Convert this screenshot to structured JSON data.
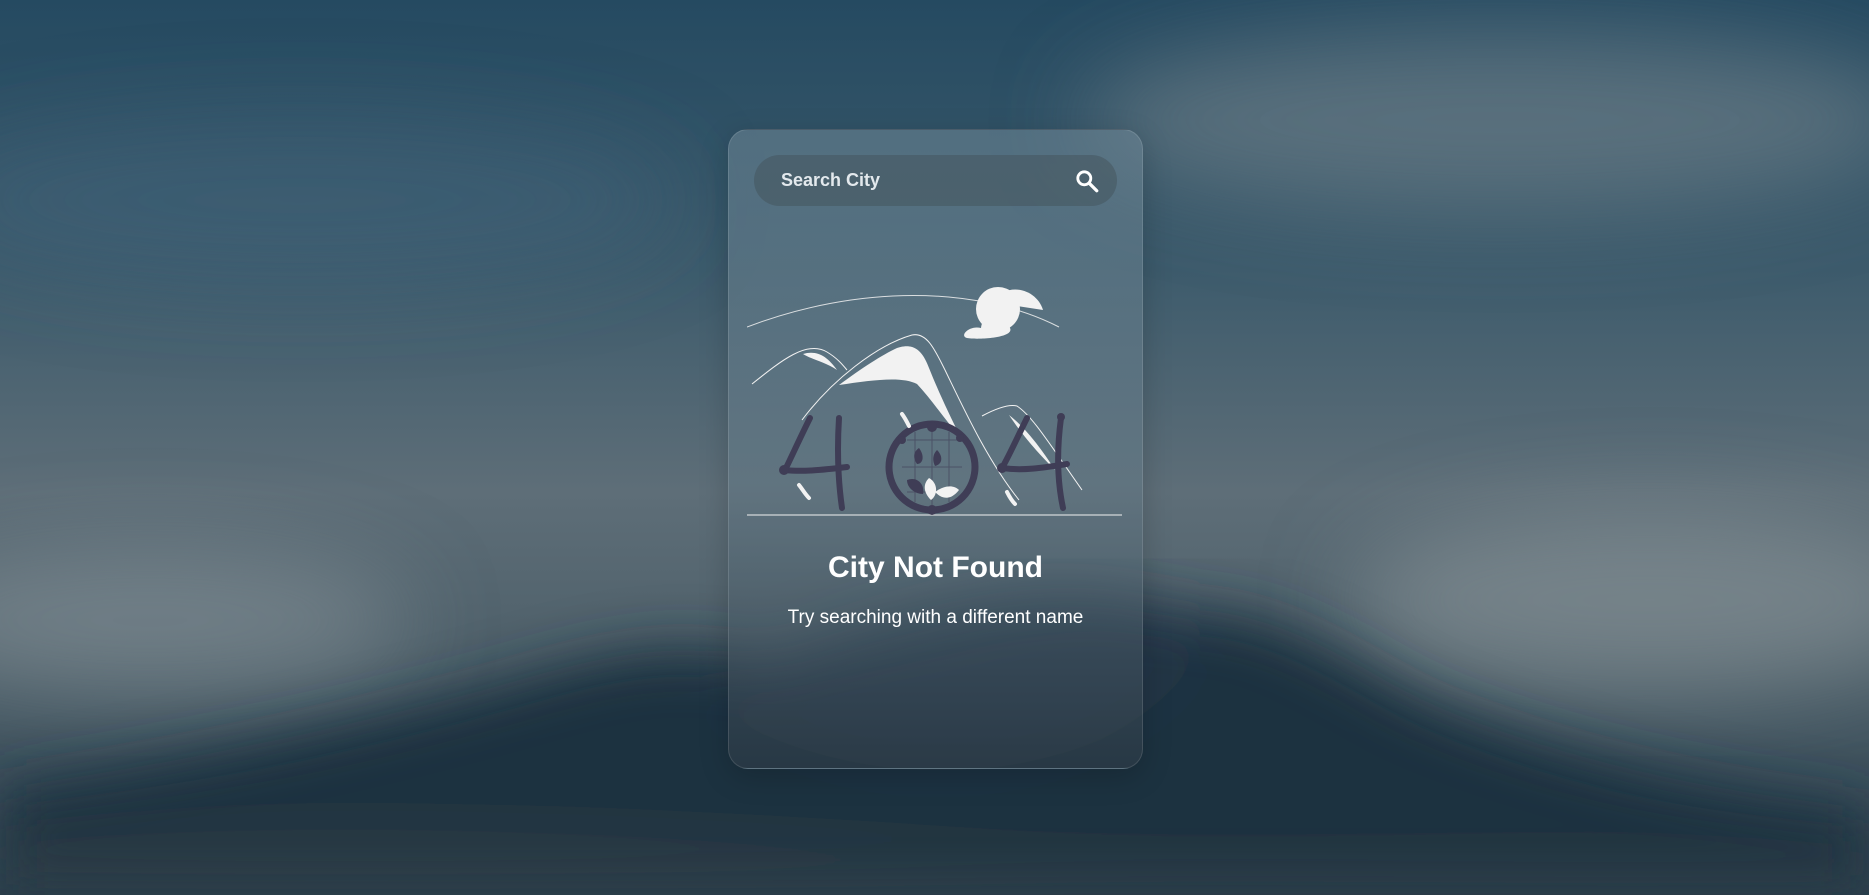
{
  "search": {
    "placeholder": "Search City",
    "icon": "search-icon"
  },
  "error": {
    "illustration_icon": "404-mountains-illustration",
    "title": "City Not Found",
    "message": "Try searching with a different name"
  },
  "colors": {
    "card_glass": "#6f8896",
    "text": "#ffffff",
    "illustration_dark": "#3f3d56",
    "illustration_light": "#f2f2f2"
  }
}
